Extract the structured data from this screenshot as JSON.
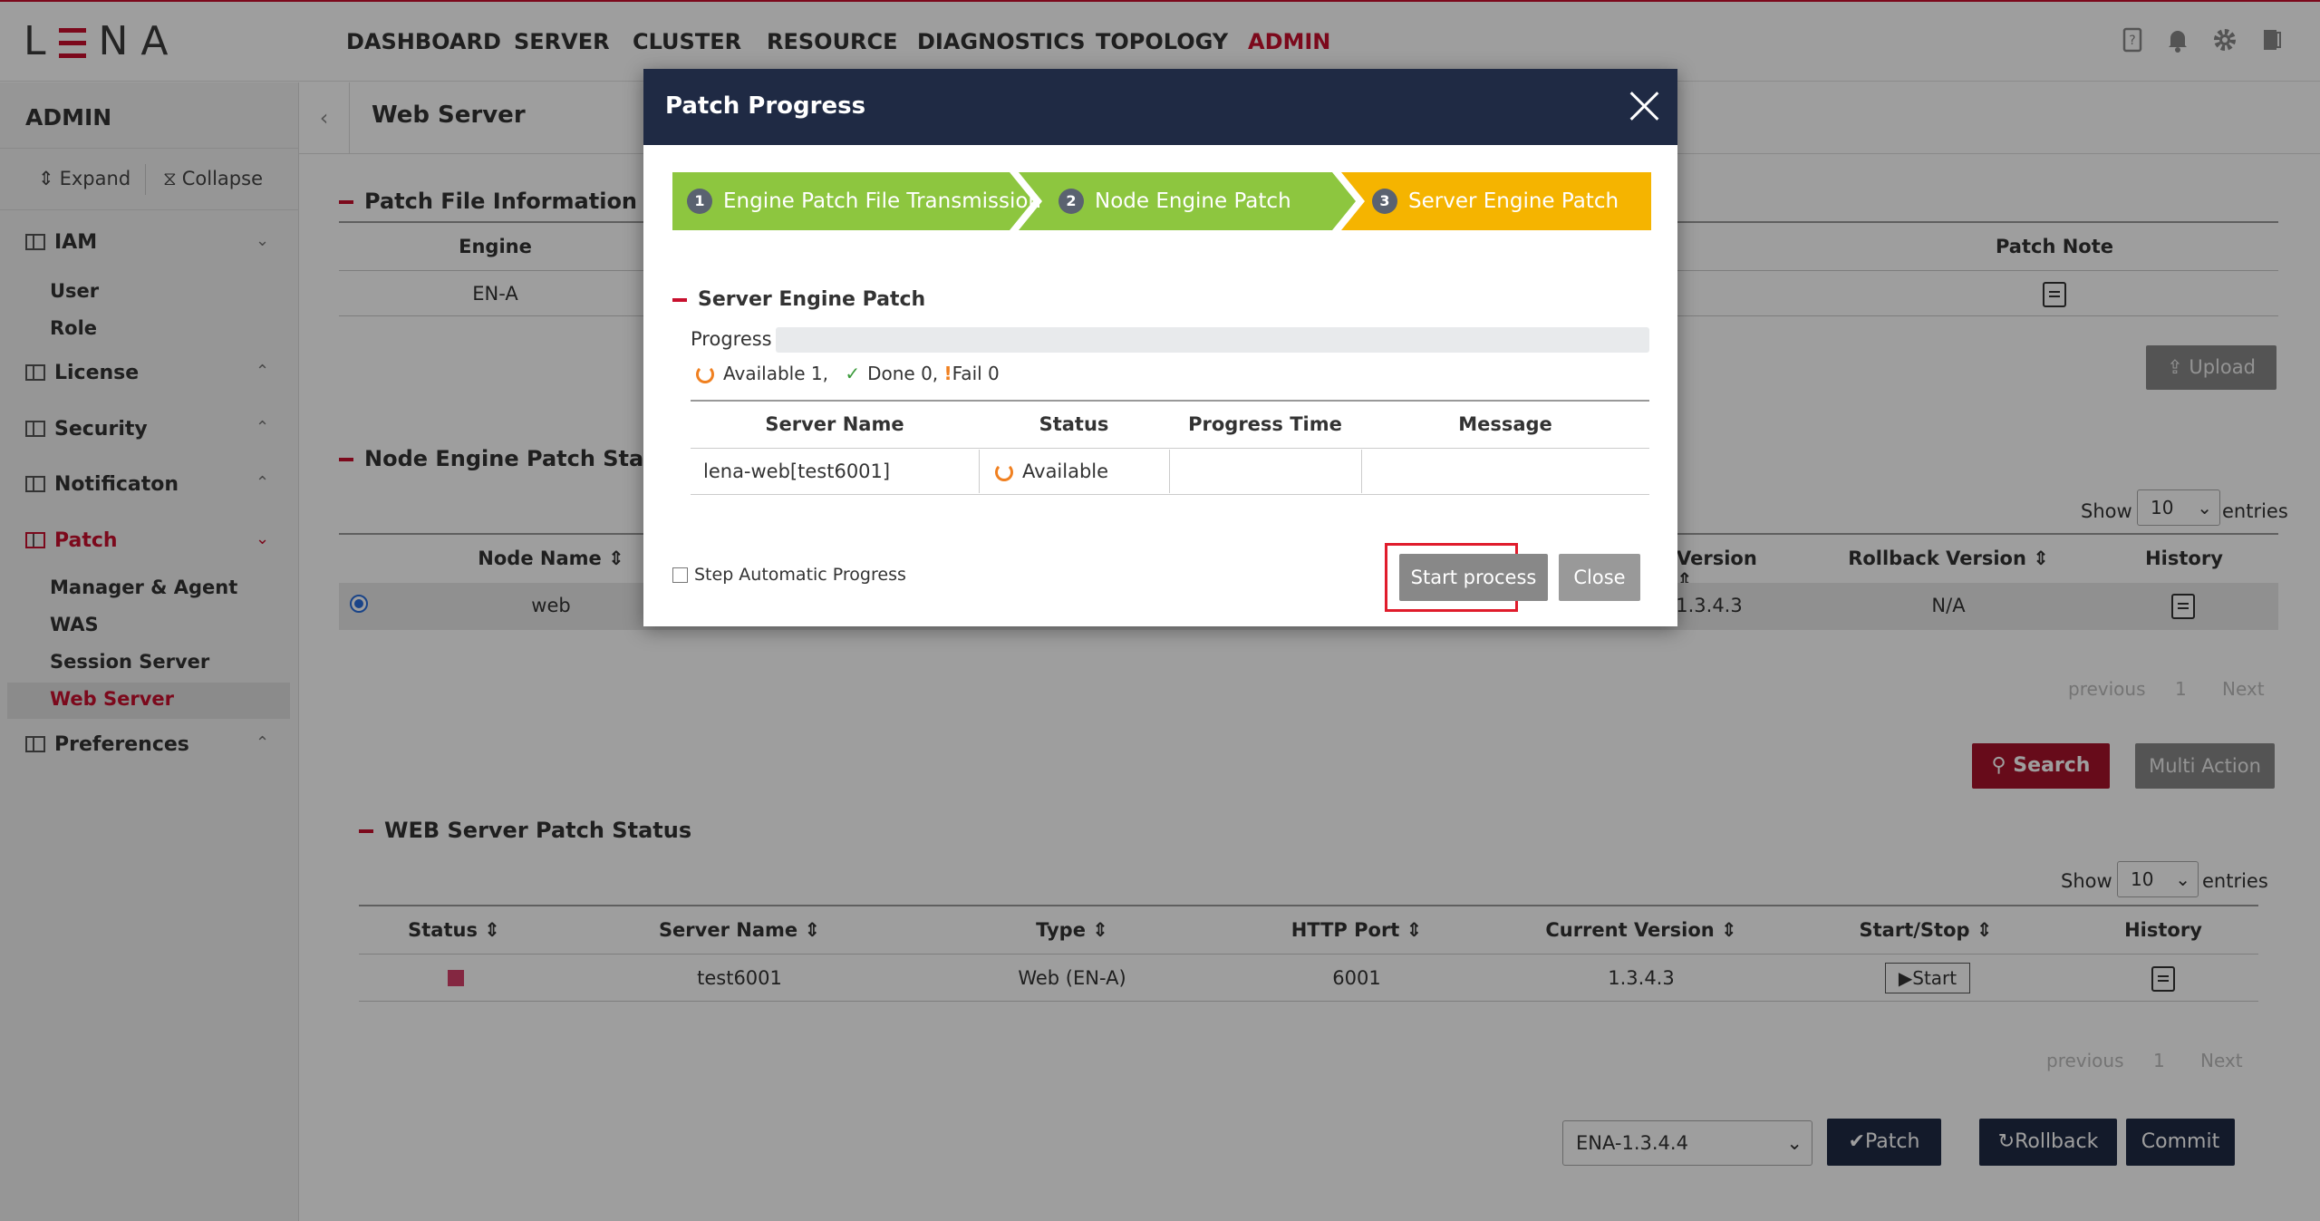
{
  "topbar": {
    "logo_text": "LENA",
    "nav": [
      "DASHBOARD",
      "SERVER",
      "CLUSTER",
      "RESOURCE",
      "DIAGNOSTICS",
      "TOPOLOGY",
      "ADMIN"
    ],
    "active_nav": "ADMIN",
    "icons": [
      "help-doc-icon",
      "bell-icon",
      "gear-icon",
      "logout-icon"
    ]
  },
  "sidebar": {
    "title": "ADMIN",
    "expand_label": "Expand",
    "collapse_label": "Collapse",
    "groups": [
      {
        "label": "IAM",
        "items": [
          "User",
          "Role"
        ]
      },
      {
        "label": "License",
        "items": []
      },
      {
        "label": "Security",
        "items": []
      },
      {
        "label": "Notificaton",
        "items": []
      },
      {
        "label": "Patch",
        "items": [
          "Manager & Agent",
          "WAS",
          "Session Server",
          "Web Server"
        ]
      },
      {
        "label": "Preferences",
        "items": []
      }
    ],
    "active_item": "Web Server"
  },
  "main": {
    "title": "Web Server",
    "patch_file": {
      "heading": "Patch File Information",
      "col_engine": "Engine",
      "col_patch_note": "Patch Note",
      "engine_value": "EN-A",
      "upload_label": "Upload"
    },
    "node_status": {
      "heading": "Node Engine Patch Status",
      "show_label": "Show",
      "entries_label": "entries",
      "page_size": "10",
      "cols": [
        "Node Name",
        "Version",
        "Rollback Version",
        "History"
      ],
      "row": {
        "node": "web",
        "version": "1.3.4.3",
        "rollback": "N/A"
      },
      "pager": {
        "prev": "previous",
        "page": "1",
        "next": "Next"
      },
      "search_label": "Search",
      "multi_action_label": "Multi Action"
    },
    "web_status": {
      "heading": "WEB Server Patch Status",
      "show_label": "Show",
      "entries_label": "entries",
      "page_size": "10",
      "cols": [
        "Status",
        "Server Name",
        "Type",
        "HTTP Port",
        "Current Version",
        "Start/Stop",
        "History"
      ],
      "row": {
        "server": "test6001",
        "type": "Web (EN-A)",
        "port": "6001",
        "version": "1.3.4.3",
        "start_label": "Start"
      },
      "status_color": "#d6406a",
      "pager": {
        "prev": "previous",
        "page": "1",
        "next": "Next"
      }
    },
    "footer": {
      "version_select": "ENA-1.3.4.4",
      "patch_label": "Patch",
      "rollback_label": "Rollback",
      "commit_label": "Commit"
    }
  },
  "modal": {
    "title": "Patch Progress",
    "steps": [
      {
        "num": "1",
        "label": "Engine Patch File Transmission",
        "color": "#8dc63f"
      },
      {
        "num": "2",
        "label": "Node Engine Patch",
        "color": "#8dc63f"
      },
      {
        "num": "3",
        "label": "Server Engine Patch",
        "color": "#f5b400"
      }
    ],
    "section_title": "Server Engine Patch",
    "progress_label": "Progress",
    "progress_value": 0,
    "counts": {
      "available": "Available 1,",
      "done": "Done 0,",
      "fail": "Fail 0"
    },
    "cols": [
      "Server Name",
      "Status",
      "Progress Time",
      "Message"
    ],
    "row": {
      "server": "lena-web[test6001]",
      "status": "Available",
      "time": "",
      "message": ""
    },
    "step_auto_label": "Step Automatic Progress",
    "start_label": "Start process",
    "close_label": "Close"
  }
}
